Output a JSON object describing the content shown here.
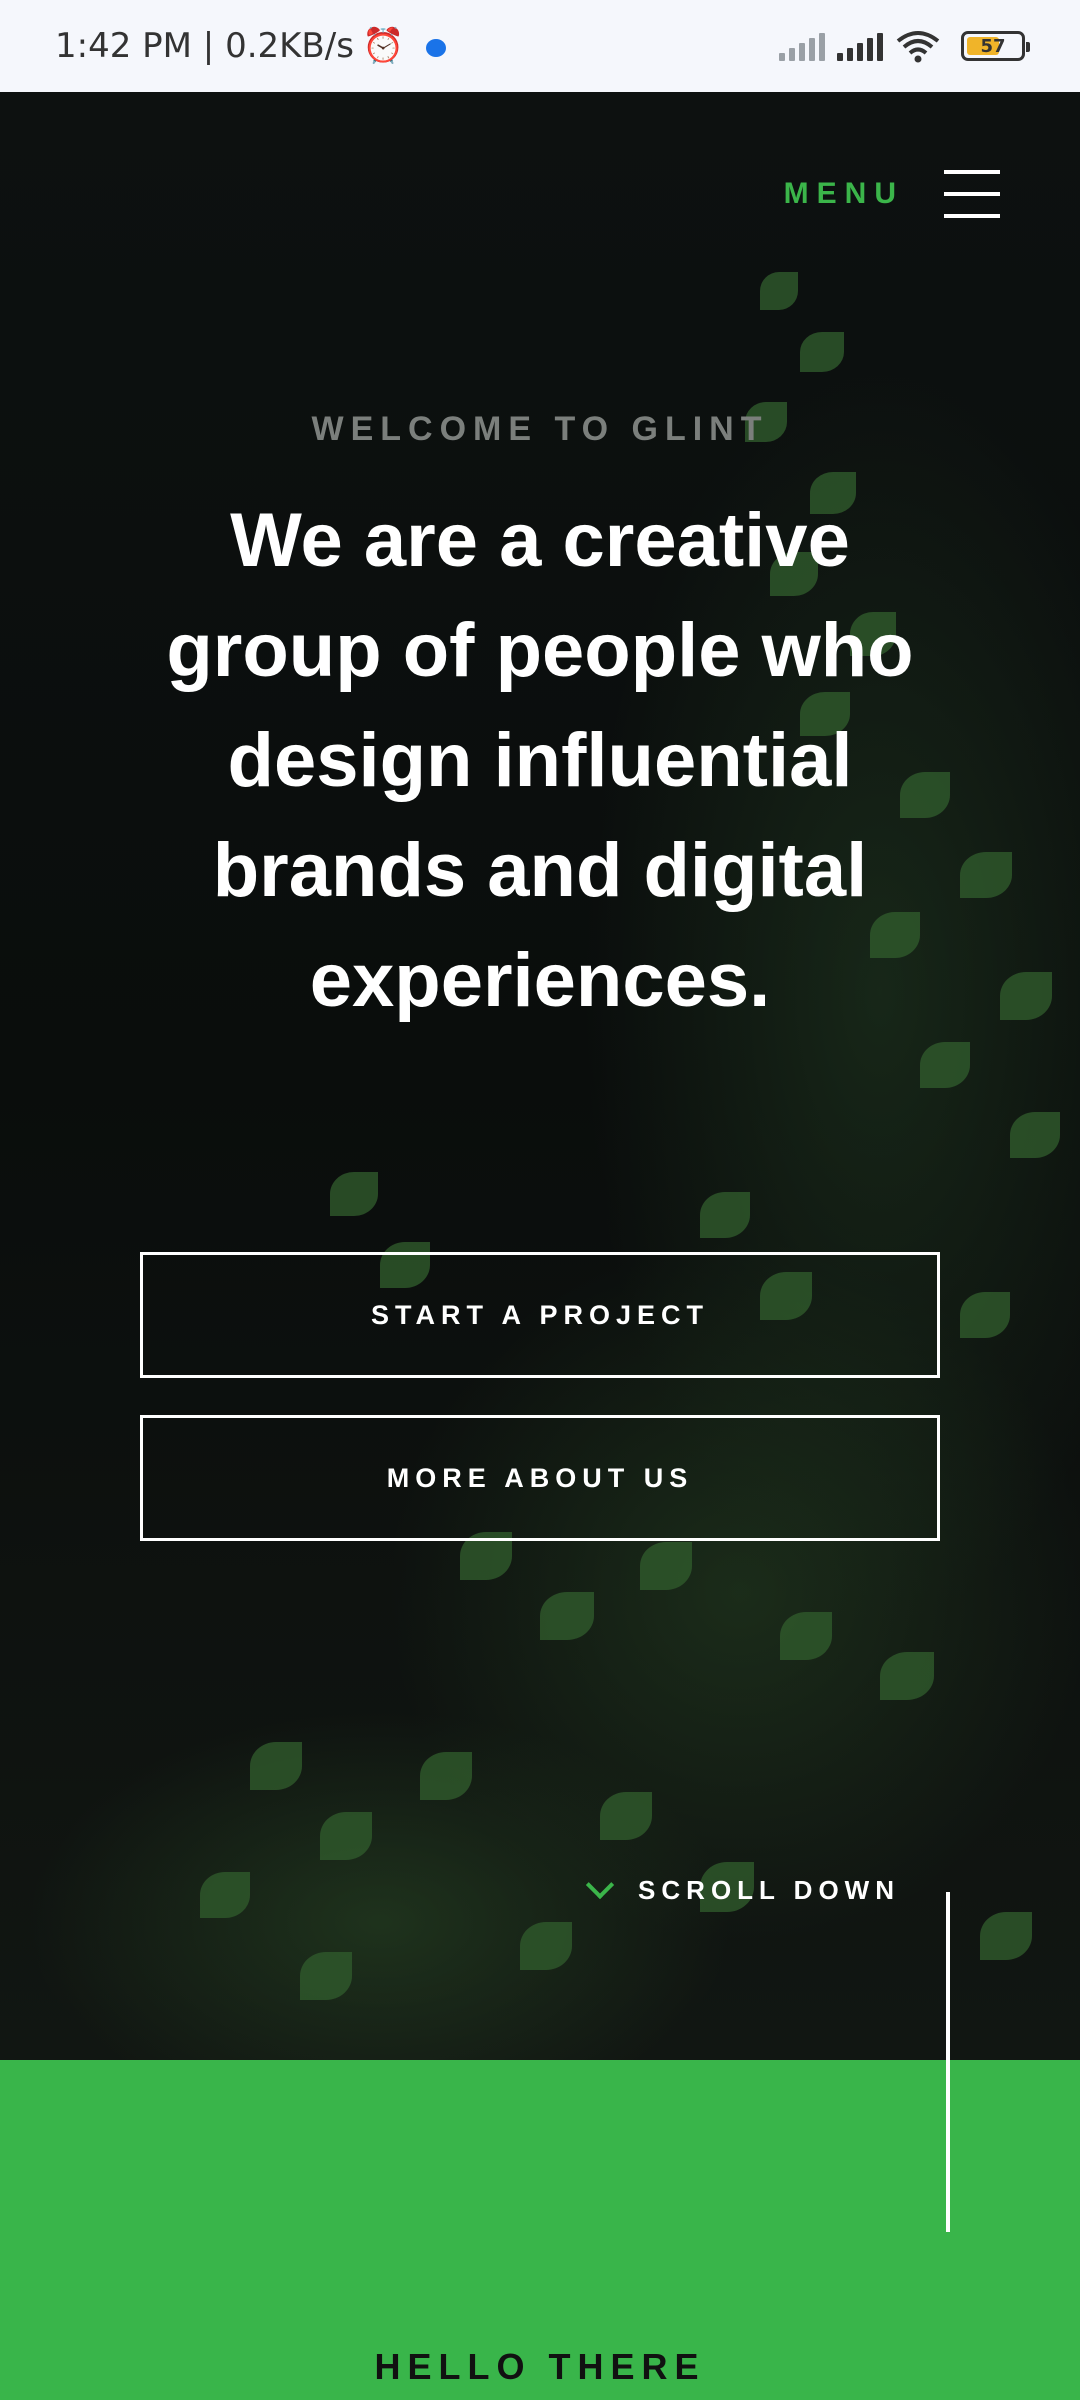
{
  "status_bar": {
    "time_speed": "1:42 PM | 0.2KB/s",
    "alarm_icon": "alarm-clock-icon",
    "message_icon": "chat-bubble-icon",
    "battery_level": "57"
  },
  "header": {
    "menu_label": "MENU",
    "menu_icon": "hamburger-icon"
  },
  "hero": {
    "welcome": "WELCOME TO GLINT",
    "headline": "We are a creative group of people who design influential brands and digital experiences.",
    "buttons": {
      "start_project": "START A PROJECT",
      "more_about": "MORE ABOUT US"
    },
    "scroll_label": "SCROLL DOWN"
  },
  "about": {
    "heading": "HELLO THERE"
  },
  "colors": {
    "accent": "#39b54a",
    "background": "#0b0e0d",
    "text": "#ffffff"
  }
}
